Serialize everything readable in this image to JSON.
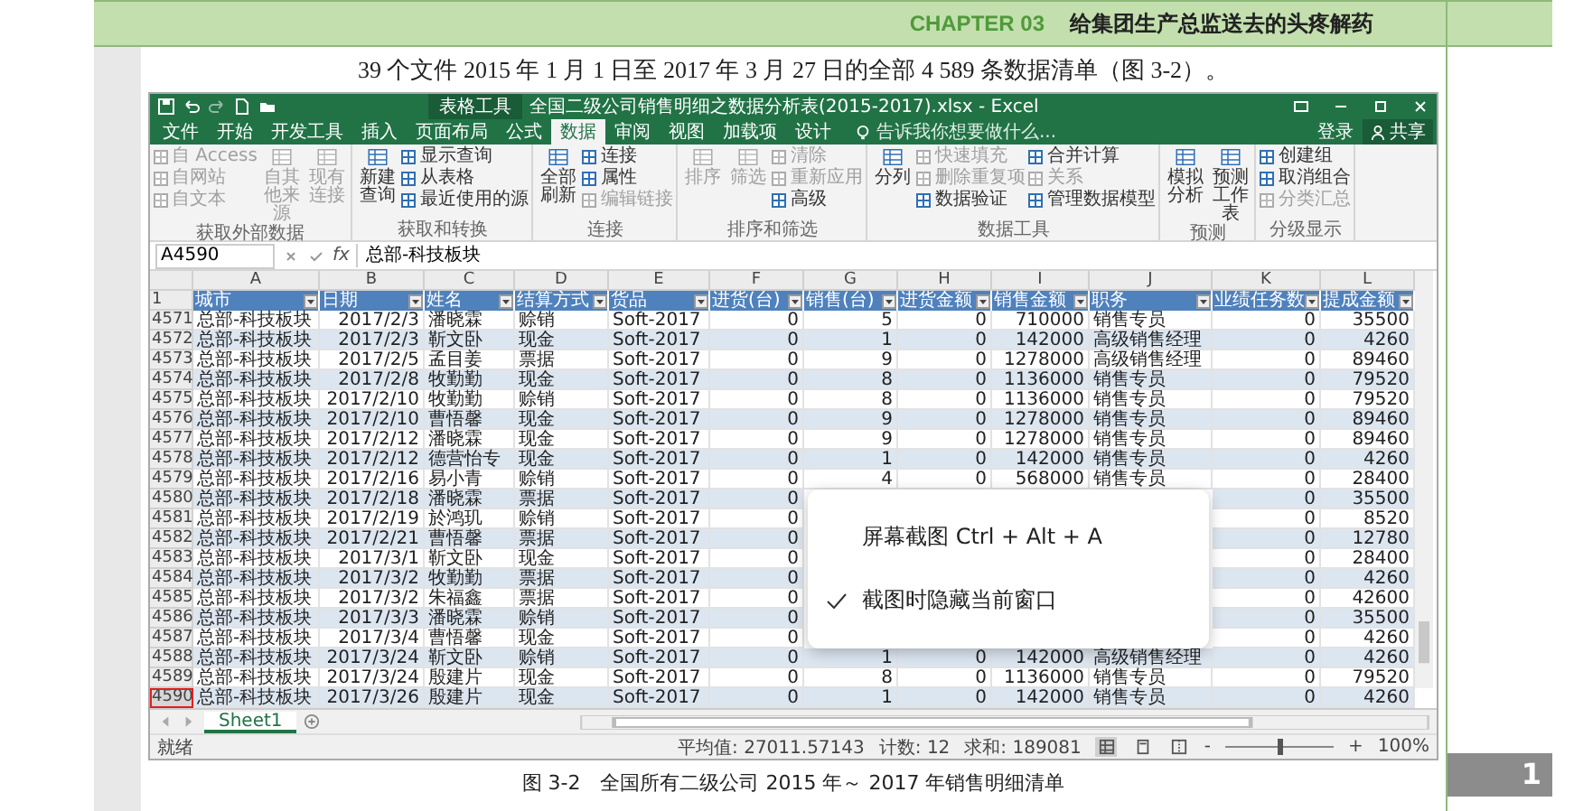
{
  "header": {
    "chapter": "CHAPTER 03",
    "title": "给集团生产总监送去的头疼解药"
  },
  "paragraph": "39 个文件 2015 年 1 月 1 日至 2017 年 3 月 27 日的全部 4 589 条数据清单（图 3-2）。",
  "excel": {
    "context_tab": "表格工具",
    "title": "全国二级公司销售明细之数据分析表(2015-2017).xlsx - Excel",
    "tabs": [
      {
        "label": "文件",
        "selected": false
      },
      {
        "label": "开始",
        "selected": false
      },
      {
        "label": "开发工具",
        "selected": false
      },
      {
        "label": "插入",
        "selected": false
      },
      {
        "label": "页面布局",
        "selected": false
      },
      {
        "label": "公式",
        "selected": false
      },
      {
        "label": "数据",
        "selected": true
      },
      {
        "label": "审阅",
        "selected": false
      },
      {
        "label": "视图",
        "selected": false
      },
      {
        "label": "加载项",
        "selected": false
      },
      {
        "label": "设计",
        "selected": false
      }
    ],
    "tell_me": "告诉我你想要做什么...",
    "sign_in": "登录",
    "share": "共享",
    "ribbon_groups": [
      {
        "label": "获取外部数据",
        "columns": [
          {
            "kind": "stack",
            "items": [
              {
                "label": "自 Access",
                "disabled": true
              },
              {
                "label": "自网站",
                "disabled": true
              },
              {
                "label": "自文本",
                "disabled": true
              }
            ]
          },
          {
            "kind": "big",
            "items": [
              {
                "label": "自其他来源",
                "disabled": true
              }
            ]
          },
          {
            "kind": "big",
            "items": [
              {
                "label": "现有连接",
                "disabled": true
              }
            ]
          }
        ]
      },
      {
        "label": "获取和转换",
        "columns": [
          {
            "kind": "big",
            "items": [
              {
                "label": "新建查询",
                "disabled": false
              }
            ]
          },
          {
            "kind": "stack",
            "items": [
              {
                "label": "显示查询",
                "disabled": false
              },
              {
                "label": "从表格",
                "disabled": false
              },
              {
                "label": "最近使用的源",
                "disabled": false
              }
            ]
          }
        ]
      },
      {
        "label": "连接",
        "columns": [
          {
            "kind": "big",
            "items": [
              {
                "label": "全部刷新",
                "disabled": false
              }
            ]
          },
          {
            "kind": "stack",
            "items": [
              {
                "label": "连接",
                "disabled": false
              },
              {
                "label": "属性",
                "disabled": false
              },
              {
                "label": "编辑链接",
                "disabled": true
              }
            ]
          }
        ]
      },
      {
        "label": "排序和筛选",
        "columns": [
          {
            "kind": "big",
            "items": [
              {
                "label": "排序",
                "disabled": true
              }
            ]
          },
          {
            "kind": "big",
            "items": [
              {
                "label": "筛选",
                "disabled": true
              }
            ]
          },
          {
            "kind": "stack",
            "items": [
              {
                "label": "清除",
                "disabled": true
              },
              {
                "label": "重新应用",
                "disabled": true
              },
              {
                "label": "高级",
                "disabled": false
              }
            ]
          }
        ]
      },
      {
        "label": "数据工具",
        "columns": [
          {
            "kind": "big",
            "items": [
              {
                "label": "分列",
                "disabled": false
              }
            ]
          },
          {
            "kind": "stack",
            "items": [
              {
                "label": "快速填充",
                "disabled": true
              },
              {
                "label": "删除重复项",
                "disabled": true
              },
              {
                "label": "数据验证",
                "disabled": false
              }
            ]
          },
          {
            "kind": "stack",
            "items": [
              {
                "label": "合并计算",
                "disabled": false
              },
              {
                "label": "关系",
                "disabled": true
              },
              {
                "label": "管理数据模型",
                "disabled": false
              }
            ]
          }
        ]
      },
      {
        "label": "预测",
        "columns": [
          {
            "kind": "big",
            "items": [
              {
                "label": "模拟分析",
                "disabled": false
              }
            ]
          },
          {
            "kind": "big",
            "items": [
              {
                "label": "预测工作表",
                "disabled": false
              }
            ]
          }
        ]
      },
      {
        "label": "分级显示",
        "columns": [
          {
            "kind": "stack",
            "items": [
              {
                "label": "创建组",
                "disabled": false
              },
              {
                "label": "取消组合",
                "disabled": false
              },
              {
                "label": "分类汇总",
                "disabled": true
              }
            ]
          }
        ]
      }
    ],
    "name_box": "A4590",
    "function_label": "fx",
    "formula": "总部-科技板块",
    "column_letters": [
      "A",
      "B",
      "C",
      "D",
      "E",
      "F",
      "G",
      "H",
      "I",
      "J",
      "K",
      "L"
    ],
    "header_row": {
      "number": "1",
      "cells": [
        "城市",
        "日期",
        "姓名",
        "结算方式",
        "货品",
        "进货(台)",
        "销售(台)",
        "进货金额",
        "销售金额",
        "职务",
        "业绩任务数",
        "提成金额"
      ]
    },
    "rows": [
      {
        "number": "4571",
        "selected": false,
        "cells": [
          "总部-科技板块",
          "2017/2/3",
          "潘晓霖",
          "赊销",
          "Soft-2017",
          "0",
          "5",
          "0",
          "710000",
          "销售专员",
          "0",
          "35500"
        ]
      },
      {
        "number": "4572",
        "selected": false,
        "cells": [
          "总部-科技板块",
          "2017/2/3",
          "靳文卧",
          "现金",
          "Soft-2017",
          "0",
          "1",
          "0",
          "142000",
          "高级销售经理",
          "0",
          "4260"
        ]
      },
      {
        "number": "4573",
        "selected": false,
        "cells": [
          "总部-科技板块",
          "2017/2/5",
          "孟目姜",
          "票据",
          "Soft-2017",
          "0",
          "9",
          "0",
          "1278000",
          "高级销售经理",
          "0",
          "89460"
        ]
      },
      {
        "number": "4574",
        "selected": false,
        "cells": [
          "总部-科技板块",
          "2017/2/8",
          "牧勤勤",
          "现金",
          "Soft-2017",
          "0",
          "8",
          "0",
          "1136000",
          "销售专员",
          "0",
          "79520"
        ]
      },
      {
        "number": "4575",
        "selected": false,
        "cells": [
          "总部-科技板块",
          "2017/2/10",
          "牧勤勤",
          "赊销",
          "Soft-2017",
          "0",
          "8",
          "0",
          "1136000",
          "销售专员",
          "0",
          "79520"
        ]
      },
      {
        "number": "4576",
        "selected": false,
        "cells": [
          "总部-科技板块",
          "2017/2/10",
          "曹悟馨",
          "现金",
          "Soft-2017",
          "0",
          "9",
          "0",
          "1278000",
          "销售专员",
          "0",
          "89460"
        ]
      },
      {
        "number": "4577",
        "selected": false,
        "cells": [
          "总部-科技板块",
          "2017/2/12",
          "潘晓霖",
          "现金",
          "Soft-2017",
          "0",
          "9",
          "0",
          "1278000",
          "销售专员",
          "0",
          "89460"
        ]
      },
      {
        "number": "4578",
        "selected": false,
        "cells": [
          "总部-科技板块",
          "2017/2/12",
          "德营怡专",
          "现金",
          "Soft-2017",
          "0",
          "1",
          "0",
          "142000",
          "销售专员",
          "0",
          "4260"
        ]
      },
      {
        "number": "4579",
        "selected": false,
        "cells": [
          "总部-科技板块",
          "2017/2/16",
          "易小青",
          "赊销",
          "Soft-2017",
          "0",
          "4",
          "0",
          "568000",
          "销售专员",
          "0",
          "28400"
        ]
      },
      {
        "number": "4580",
        "selected": false,
        "cells": [
          "总部-科技板块",
          "2017/2/18",
          "潘晓霖",
          "票据",
          "Soft-2017",
          "0",
          null,
          null,
          null,
          null,
          "0",
          "35500"
        ]
      },
      {
        "number": "4581",
        "selected": false,
        "cells": [
          "总部-科技板块",
          "2017/2/19",
          "於鸿玑",
          "赊销",
          "Soft-2017",
          "0",
          null,
          null,
          null,
          null,
          "0",
          "8520"
        ]
      },
      {
        "number": "4582",
        "selected": false,
        "cells": [
          "总部-科技板块",
          "2017/2/21",
          "曹悟馨",
          "票据",
          "Soft-2017",
          "0",
          null,
          null,
          null,
          null,
          "0",
          "12780"
        ]
      },
      {
        "number": "4583",
        "selected": false,
        "cells": [
          "总部-科技板块",
          "2017/3/1",
          "靳文卧",
          "现金",
          "Soft-2017",
          "0",
          null,
          null,
          null,
          null,
          "0",
          "28400"
        ]
      },
      {
        "number": "4584",
        "selected": false,
        "cells": [
          "总部-科技板块",
          "2017/3/2",
          "牧勤勤",
          "票据",
          "Soft-2017",
          "0",
          null,
          null,
          null,
          null,
          "0",
          "4260"
        ]
      },
      {
        "number": "4585",
        "selected": false,
        "cells": [
          "总部-科技板块",
          "2017/3/2",
          "朱福鑫",
          "票据",
          "Soft-2017",
          "0",
          null,
          null,
          null,
          null,
          "0",
          "42600"
        ]
      },
      {
        "number": "4586",
        "selected": false,
        "cells": [
          "总部-科技板块",
          "2017/3/3",
          "潘晓霖",
          "赊销",
          "Soft-2017",
          "0",
          null,
          null,
          null,
          null,
          "0",
          "35500"
        ]
      },
      {
        "number": "4587",
        "selected": false,
        "cells": [
          "总部-科技板块",
          "2017/3/4",
          "曹悟馨",
          "现金",
          "Soft-2017",
          "0",
          null,
          null,
          null,
          null,
          "0",
          "4260"
        ]
      },
      {
        "number": "4588",
        "selected": false,
        "cells": [
          "总部-科技板块",
          "2017/3/24",
          "靳文卧",
          "赊销",
          "Soft-2017",
          "0",
          "1",
          "0",
          "142000",
          "高级销售经理",
          "0",
          "4260"
        ]
      },
      {
        "number": "4589",
        "selected": false,
        "cells": [
          "总部-科技板块",
          "2017/3/24",
          "殷建片",
          "现金",
          "Soft-2017",
          "0",
          "8",
          "0",
          "1136000",
          "销售专员",
          "0",
          "79520"
        ]
      },
      {
        "number": "4590",
        "selected": true,
        "cells": [
          "总部-科技板块",
          "2017/3/26",
          "殷建片",
          "现金",
          "Soft-2017",
          "0",
          "1",
          "0",
          "142000",
          "销售专员",
          "0",
          "4260"
        ]
      }
    ],
    "sheet_tabs": [
      {
        "label": "Sheet1",
        "selected": true
      }
    ],
    "status_bar": {
      "ready": "就绪",
      "stats": [
        "平均值: 27011.57143",
        "计数: 12",
        "求和: 189081"
      ],
      "views": [
        {
          "kind": "normal",
          "selected": true
        },
        {
          "kind": "layout",
          "selected": false
        },
        {
          "kind": "break",
          "selected": false
        }
      ],
      "zoom": {
        "minus": "-",
        "plus": "+",
        "level": 0.5,
        "reading": "100%"
      }
    }
  },
  "context_menu": {
    "items": [
      {
        "label": "屏幕截图 Ctrl + Alt + A",
        "checked": false
      },
      {
        "label": "截图时隐藏当前窗口",
        "checked": true
      }
    ]
  },
  "caption": "图 3-2　全国所有二级公司 2015 年～ 2017 年销售明细清单",
  "page_number": "1"
}
